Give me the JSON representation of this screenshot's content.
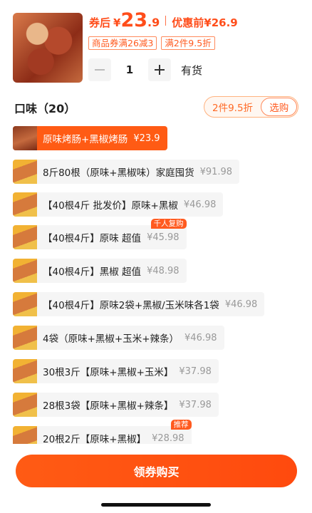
{
  "header": {
    "coupon_price_label": "券后",
    "currency": "¥",
    "coupon_price_int": "23",
    "coupon_price_dec": ".9",
    "orig_price_label": "优惠前",
    "orig_price": "¥26.9",
    "coupon_tags": [
      "商品券满26减3",
      "满2件9.5折"
    ],
    "quantity": "1",
    "stock_status": "有货"
  },
  "flavor": {
    "title": "口味（20）",
    "promo_text": "2件9.5折",
    "promo_button": "选购"
  },
  "options": [
    {
      "name": "原味烤肠+黑椒烤肠",
      "price": "¥23.9",
      "selected": true,
      "badge": ""
    },
    {
      "name": "8斤80根（原味+黑椒味）家庭囤货",
      "price": "¥91.98",
      "selected": false,
      "badge": ""
    },
    {
      "name": "【40根4斤 批发价】原味+黑椒",
      "price": "¥46.98",
      "selected": false,
      "badge": ""
    },
    {
      "name": "【40根4斤】原味 超值",
      "price": "¥45.98",
      "selected": false,
      "badge": "千人复购"
    },
    {
      "name": "【40根4斤】黑椒 超值",
      "price": "¥48.98",
      "selected": false,
      "badge": ""
    },
    {
      "name": "【40根4斤】原味2袋+黑椒/玉米味各1袋",
      "price": "¥46.98",
      "selected": false,
      "badge": ""
    },
    {
      "name": "4袋（原味+黑椒+玉米+辣条）",
      "price": "¥46.98",
      "selected": false,
      "badge": ""
    },
    {
      "name": "30根3斤【原味+黑椒+玉米】",
      "price": "¥37.98",
      "selected": false,
      "badge": ""
    },
    {
      "name": "28根3袋【原味+黑椒+辣条】",
      "price": "¥37.98",
      "selected": false,
      "badge": ""
    },
    {
      "name": "20根2斤【原味+黑椒】",
      "price": "¥28.98",
      "selected": false,
      "badge": "推荐"
    }
  ],
  "footer": {
    "buy_button": "领券购买"
  },
  "colors": {
    "accent": "#ff5b14",
    "price": "#ff4d1a"
  }
}
